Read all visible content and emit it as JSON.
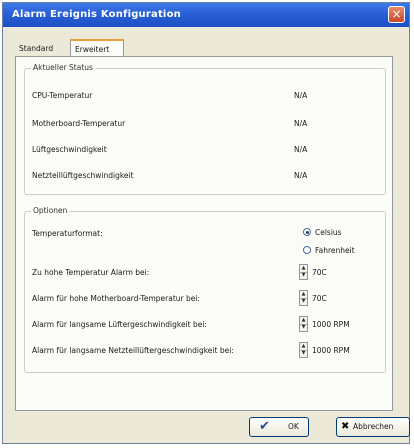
{
  "window": {
    "title": "Alarm Ereignis Konfiguration",
    "close_glyph": "×"
  },
  "tabs": [
    {
      "label": "Standard",
      "active": false
    },
    {
      "label": "Erweitert",
      "active": true
    }
  ],
  "status": {
    "legend": "Aktueller Status",
    "rows": [
      {
        "label": "CPU-Temperatur",
        "value": "N/A"
      },
      {
        "label": "Motherboard-Temperatur",
        "value": "N/A"
      },
      {
        "label": "Lüftgeschwindigkeit",
        "value": "N/A"
      },
      {
        "label": "Netzteillüftgeschwindigkeit",
        "value": "N/A"
      }
    ]
  },
  "options": {
    "legend": "Optionen",
    "temp_format_label": "Temperaturformat:",
    "celsius_label": "Celsius",
    "fahrenheit_label": "Fahrenheit",
    "selected_format": "Celsius",
    "thresholds": [
      {
        "label": "Zu hohe Temperatur Alarm bei:",
        "value": "70C"
      },
      {
        "label": "Alarm für hohe Motherboard-Temperatur bei:",
        "value": "70C"
      },
      {
        "label": "Alarm für langsame Lüftergeschwindigkeit bei:",
        "value": "1000 RPM"
      },
      {
        "label": "Alarm für langsame Netzteillüftergeschwindigkeit bei:",
        "value": "1000 RPM"
      }
    ]
  },
  "buttons": {
    "ok_label": "OK",
    "ok_icon": "✔",
    "cancel_label": "Abbrechen",
    "cancel_icon": "✖"
  },
  "colors": {
    "title_bar": "#2a5fd6",
    "dialog_bg": "#ece9d8",
    "panel_bg": "#fbfbf8",
    "active_tab_accent": "#e9a23b"
  }
}
